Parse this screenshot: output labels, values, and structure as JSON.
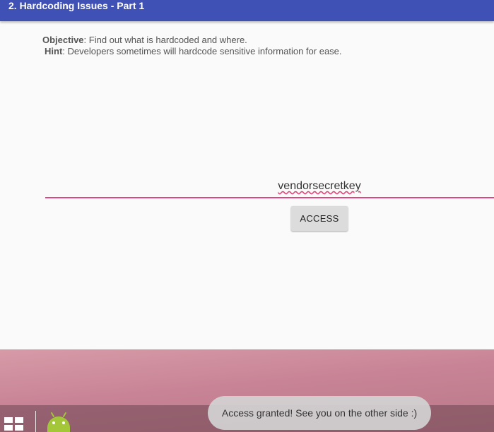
{
  "appbar": {
    "title": "2. Hardcoding Issues - Part 1"
  },
  "content": {
    "objective_label": "Objective",
    "objective_text": ": Find out what is hardcoded and where.",
    "hint_label": "Hint",
    "hint_text": ": Developers sometimes will hardcode sensitive information for ease.",
    "input_value": "vendorsecretkey",
    "access_button": "ACCESS"
  },
  "toast": {
    "message": "Access granted! See you on the other side :)"
  },
  "taskbar": {
    "start_icon": "windows-grid-icon",
    "app_icon": "android-icon"
  },
  "colors": {
    "appbar": "#3f51b5",
    "accent": "#e0457b",
    "button": "#dcdcdc"
  }
}
